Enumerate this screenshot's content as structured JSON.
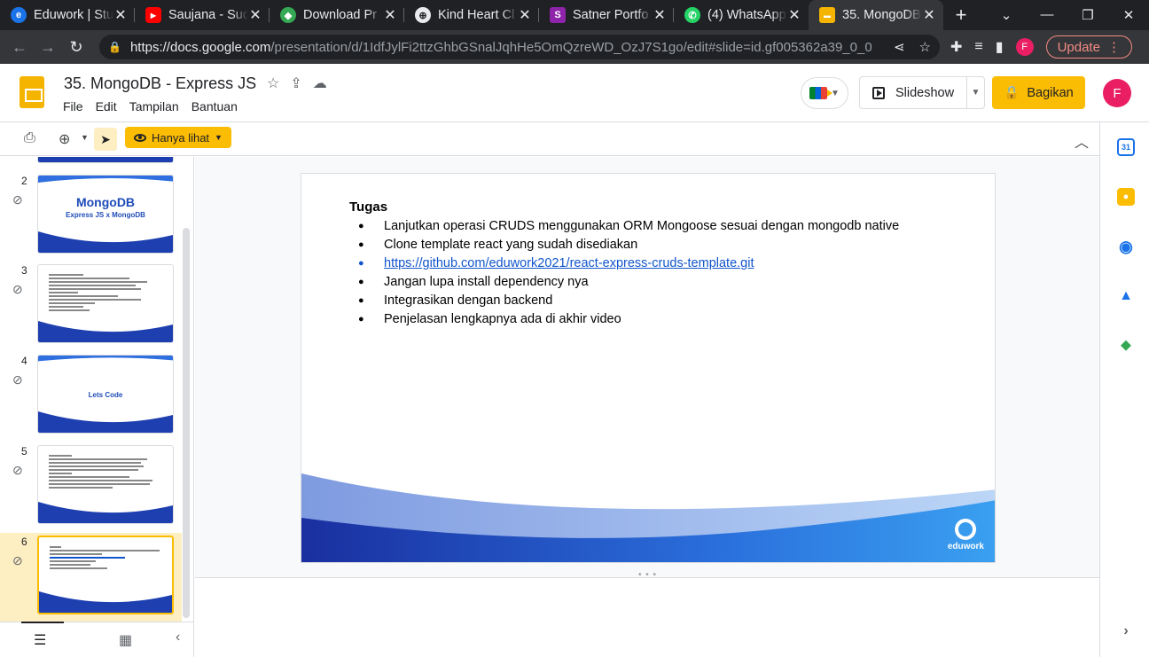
{
  "browser": {
    "tabs": [
      {
        "title": "Eduwork | Stu",
        "color": "#1a73e8",
        "glyph": "e"
      },
      {
        "title": "Saujana - Sud",
        "color": "#ff0000",
        "glyph": "▶"
      },
      {
        "title": "Download Pr",
        "color": "#34a853",
        "glyph": "◆"
      },
      {
        "title": "Kind Heart Cl",
        "color": "#5f6368",
        "glyph": "⊕"
      },
      {
        "title": "Satner Portfo",
        "color": "#8e24aa",
        "glyph": "S"
      },
      {
        "title": "(4) WhatsApp",
        "color": "#25d366",
        "glyph": "✆"
      },
      {
        "title": "35. MongoDB",
        "color": "#f4b400",
        "glyph": "▬"
      }
    ],
    "url_host": "https://docs.google.com",
    "url_rest": "/presentation/d/1IdfJylFi2ttzGhbGSnalJqhHe5OmQzreWD_OzJ7S1go/edit#slide=id.gf005362a39_0_0",
    "profile_initial": "F",
    "update_label": "Update"
  },
  "app": {
    "doc_title": "35. MongoDB - Express JS",
    "menu": [
      "File",
      "Edit",
      "Tampilan",
      "Bantuan"
    ],
    "slideshow_label": "Slideshow",
    "share_label": "Bagikan",
    "avatar_initial": "F",
    "view_mode_label": "Hanya lihat"
  },
  "filmstrip": {
    "slides": [
      {
        "num": "2",
        "title": "MongoDB",
        "subtitle": "Express JS x MongoDB"
      },
      {
        "num": "3"
      },
      {
        "num": "4",
        "title": "Lets Code"
      },
      {
        "num": "5"
      },
      {
        "num": "6"
      }
    ]
  },
  "slide": {
    "heading": "Tugas",
    "bullets": [
      "Lanjutkan operasi CRUDS menggunakan ORM Mongoose sesuai dengan mongodb native",
      "Clone template react yang sudah disediakan",
      "https://github.com/eduwork2021/react-express-cruds-template.git",
      "Jangan lupa install dependency nya",
      "Integrasikan dengan backend",
      "Penjelasan lengkapnya ada di akhir video"
    ],
    "logo_text": "eduwork"
  }
}
